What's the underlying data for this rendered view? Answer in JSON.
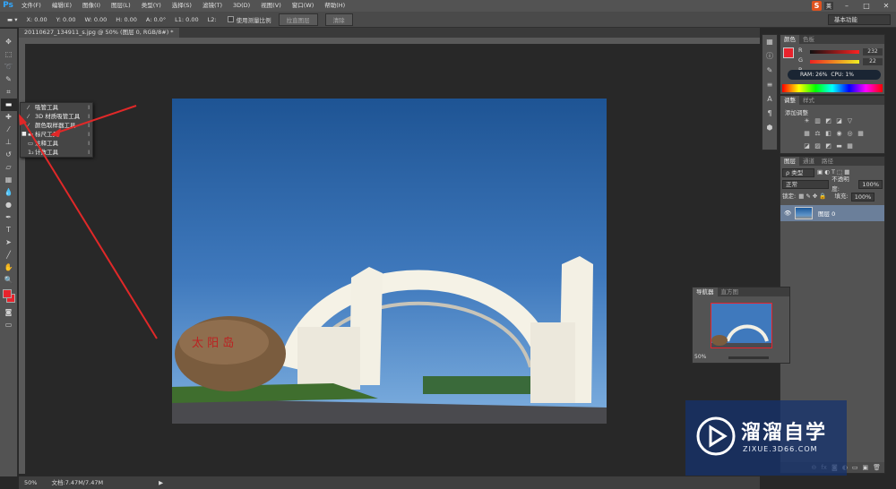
{
  "app": {
    "logo": "Ps"
  },
  "menu": [
    "文件(F)",
    "编辑(E)",
    "图像(I)",
    "图层(L)",
    "类型(Y)",
    "选择(S)",
    "滤镜(T)",
    "3D(D)",
    "视图(V)",
    "窗口(W)",
    "帮助(H)"
  ],
  "ime": {
    "logo": "S",
    "mode": "英"
  },
  "options": {
    "x": "X: 0.00",
    "y": "Y: 0.00",
    "w": "W: 0.00",
    "h": "H: 0.00",
    "a": "A: 0.0°",
    "l1": "L1: 0.00",
    "l2": "L2:",
    "use_scale": "使用测量比例",
    "straighten": "拉直图层",
    "clear": "清除",
    "workspace": "基本功能"
  },
  "document": {
    "tab_title": "20110627_134911_s.jpg @ 50% (图层 0, RGB/8#) *",
    "status_zoom": "50%",
    "status_doc": "文档:7.47M/7.47M"
  },
  "flyout": {
    "items": [
      {
        "label": "吸管工具",
        "key": "I",
        "icon": "eyedropper-icon",
        "active": false
      },
      {
        "label": "3D 材质吸管工具",
        "key": "I",
        "icon": "3d-eyedropper-icon",
        "active": false
      },
      {
        "label": "颜色取样器工具",
        "key": "I",
        "icon": "color-sampler-icon",
        "active": false
      },
      {
        "label": "标尺工具",
        "key": "I",
        "icon": "ruler-icon",
        "active": true
      },
      {
        "label": "注释工具",
        "key": "I",
        "icon": "note-icon",
        "active": false
      },
      {
        "label": "计数工具",
        "key": "I",
        "icon": "count-icon",
        "active": false
      }
    ]
  },
  "color_panel": {
    "tabs": [
      "颜色",
      "色板"
    ],
    "rows": [
      {
        "ch": "R",
        "value": "232"
      },
      {
        "ch": "G",
        "value": "22"
      },
      {
        "ch": "B",
        "value": ""
      }
    ],
    "ram": "RAM: 26%",
    "cpu": "CPU: 1%",
    "foreground": "#e8162c"
  },
  "adjust_panel": {
    "tabs": [
      "调整",
      "样式"
    ],
    "label": "添加调整"
  },
  "layers_panel": {
    "tabs": [
      "图层",
      "通道",
      "路径"
    ],
    "kind": "ρ 类型",
    "blend": "正常",
    "opacity_label": "不透明度:",
    "opacity": "100%",
    "lock_label": "锁定:",
    "fill_label": "填充:",
    "fill": "100%",
    "layer_name": "图层 0"
  },
  "navigator": {
    "tabs": [
      "导航器",
      "直方图"
    ],
    "zoom": "50%"
  },
  "watermark": {
    "title": "溜溜自学",
    "subtitle": "ZIXUE.3D66.COM"
  }
}
